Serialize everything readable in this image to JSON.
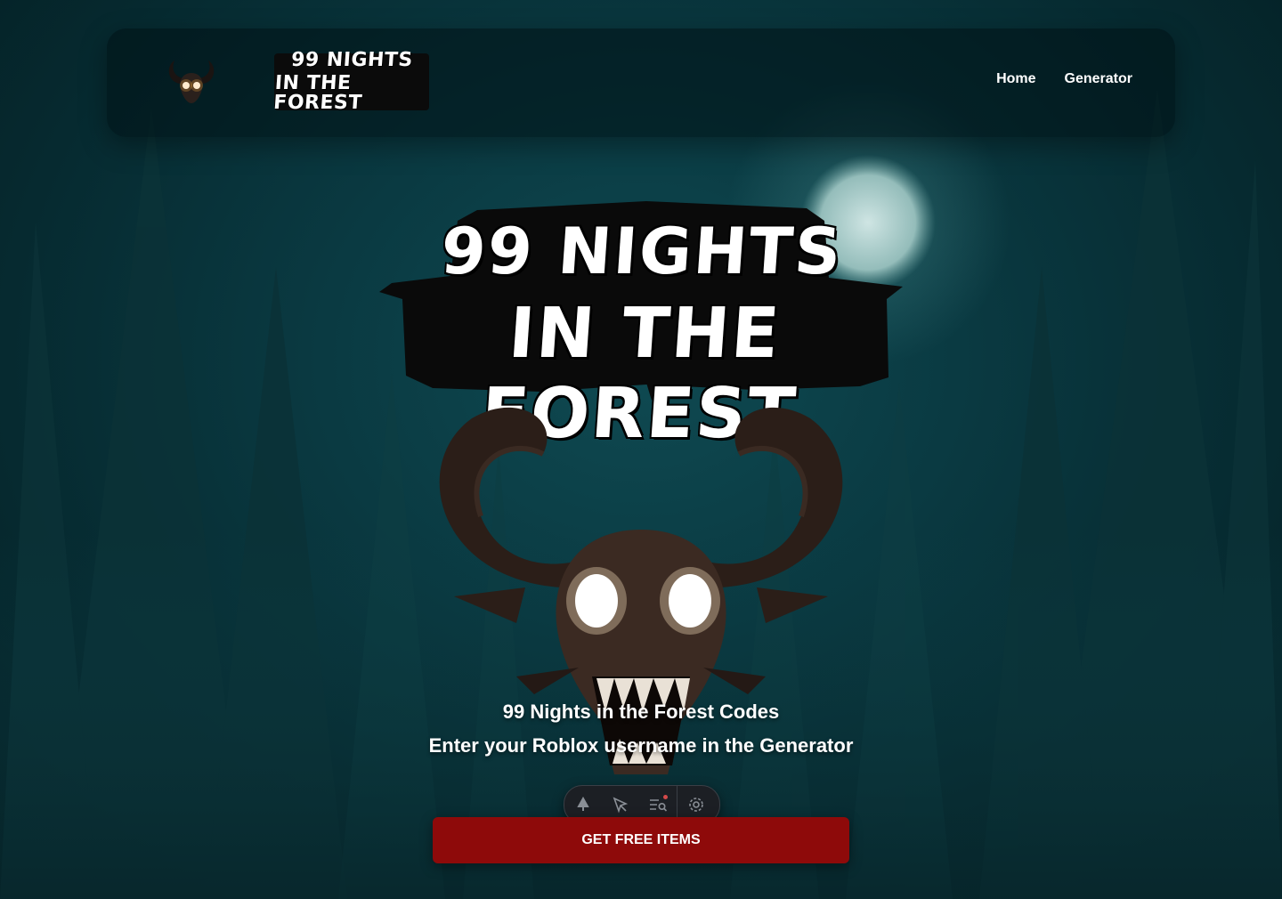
{
  "nav": {
    "logo_line1": "99 NIGHTS",
    "logo_line2": "IN THE FOREST",
    "links": [
      "Home",
      "Generator"
    ]
  },
  "hero": {
    "title_line1": "99 NIGHTS",
    "title_line2": "IN THE FOREST",
    "subtitle1": "99 Nights in the Forest Codes",
    "subtitle2": "Enter your Roblox username in the Generator",
    "cta": "GET FREE ITEMS"
  },
  "toolbar": {
    "icons": [
      "pin-icon",
      "cursor-icon",
      "search-list-icon",
      "settings-icon"
    ]
  },
  "colors": {
    "background": "#0a3a42",
    "cta": "#8e0a0a",
    "moon": "#cfe3e0"
  }
}
